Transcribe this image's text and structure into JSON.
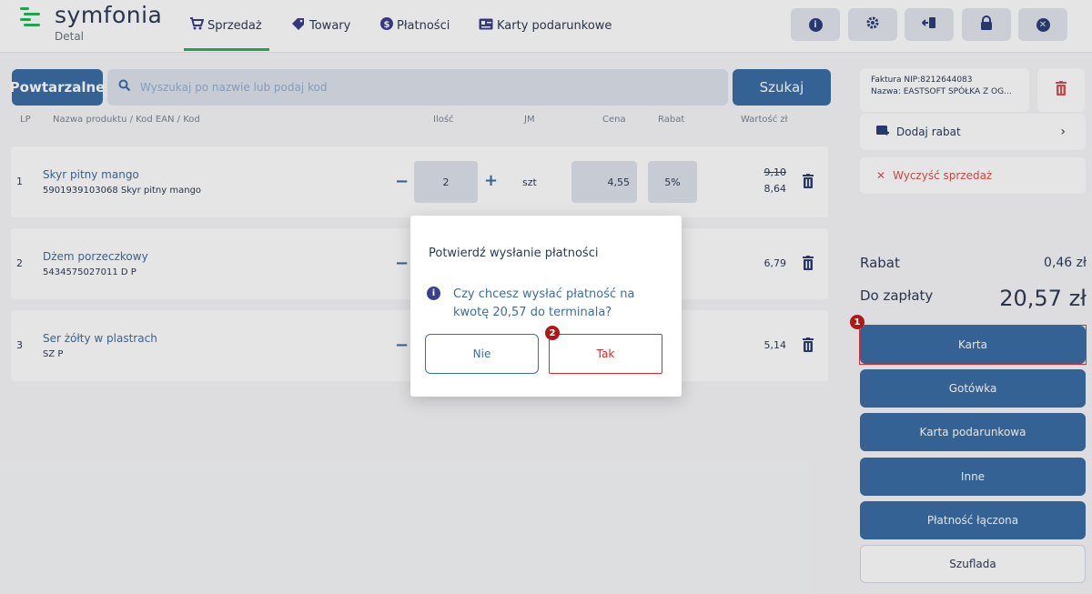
{
  "app": {
    "logo_name": "symfonia",
    "logo_sub": "Detal",
    "brand_color": "#27b45a",
    "accent_color": "#3b6ea5"
  },
  "nav": {
    "tabs": [
      {
        "label": "Sprzedaż",
        "icon": "cart-icon",
        "active": true
      },
      {
        "label": "Towary",
        "icon": "tag-icon",
        "active": false
      },
      {
        "label": "Płatności",
        "icon": "dollar-icon",
        "active": false
      },
      {
        "label": "Karty podarunkowe",
        "icon": "gift-card-icon",
        "active": false
      }
    ],
    "toolbar_icons": [
      "info-icon",
      "gear-icon",
      "logout-icon",
      "lock-icon",
      "close-icon"
    ]
  },
  "search": {
    "repeat_label": "Powtarzalne",
    "placeholder": "Wyszukaj po nazwie lub podaj kod",
    "search_label": "Szukaj"
  },
  "table": {
    "headers": {
      "lp": "LP",
      "name": "Nazwa produktu / Kod EAN / Kod",
      "qty": "Ilość",
      "jm": "JM",
      "price": "Cena",
      "discount": "Rabat",
      "value": "Wartość zł"
    },
    "rows": [
      {
        "lp": "1",
        "name": "Skyr pitny mango",
        "code": "5901939103068 Skyr pitny mango",
        "qty": "2",
        "jm": "szt",
        "price": "4,55",
        "discount": "5%",
        "old_value": "9,10",
        "value": "8,64"
      },
      {
        "lp": "2",
        "name": "Dżem porzeczkowy",
        "code": "5434575027011 D P",
        "value": "6,79"
      },
      {
        "lp": "3",
        "name": "Ser żółty w plastrach",
        "code": "SZ P",
        "value": "5,14"
      }
    ]
  },
  "panel": {
    "invoice_line1": "Faktura NIP:8212644083",
    "invoice_line2": "Nazwa: EASTSOFT SPÓŁKA Z OG...",
    "add_discount": "Dodaj rabat",
    "clear_sale": "Wyczyść sprzedaż",
    "discount_label": "Rabat",
    "discount_value": "0,46 zł",
    "to_pay_label": "Do zapłaty",
    "to_pay_value": "20,57 zł",
    "payment_buttons": [
      "Karta",
      "Gotówka",
      "Karta podarunkowa",
      "Inne",
      "Płatność łączona",
      "Szuflada"
    ]
  },
  "dialog": {
    "title": "Potwierdź wysłanie płatności",
    "question": "Czy chcesz wysłać płatność na kwotę 20,57 do terminala?",
    "no_label": "Nie",
    "yes_label": "Tak"
  },
  "markers": {
    "m1": "1",
    "m2": "2"
  }
}
